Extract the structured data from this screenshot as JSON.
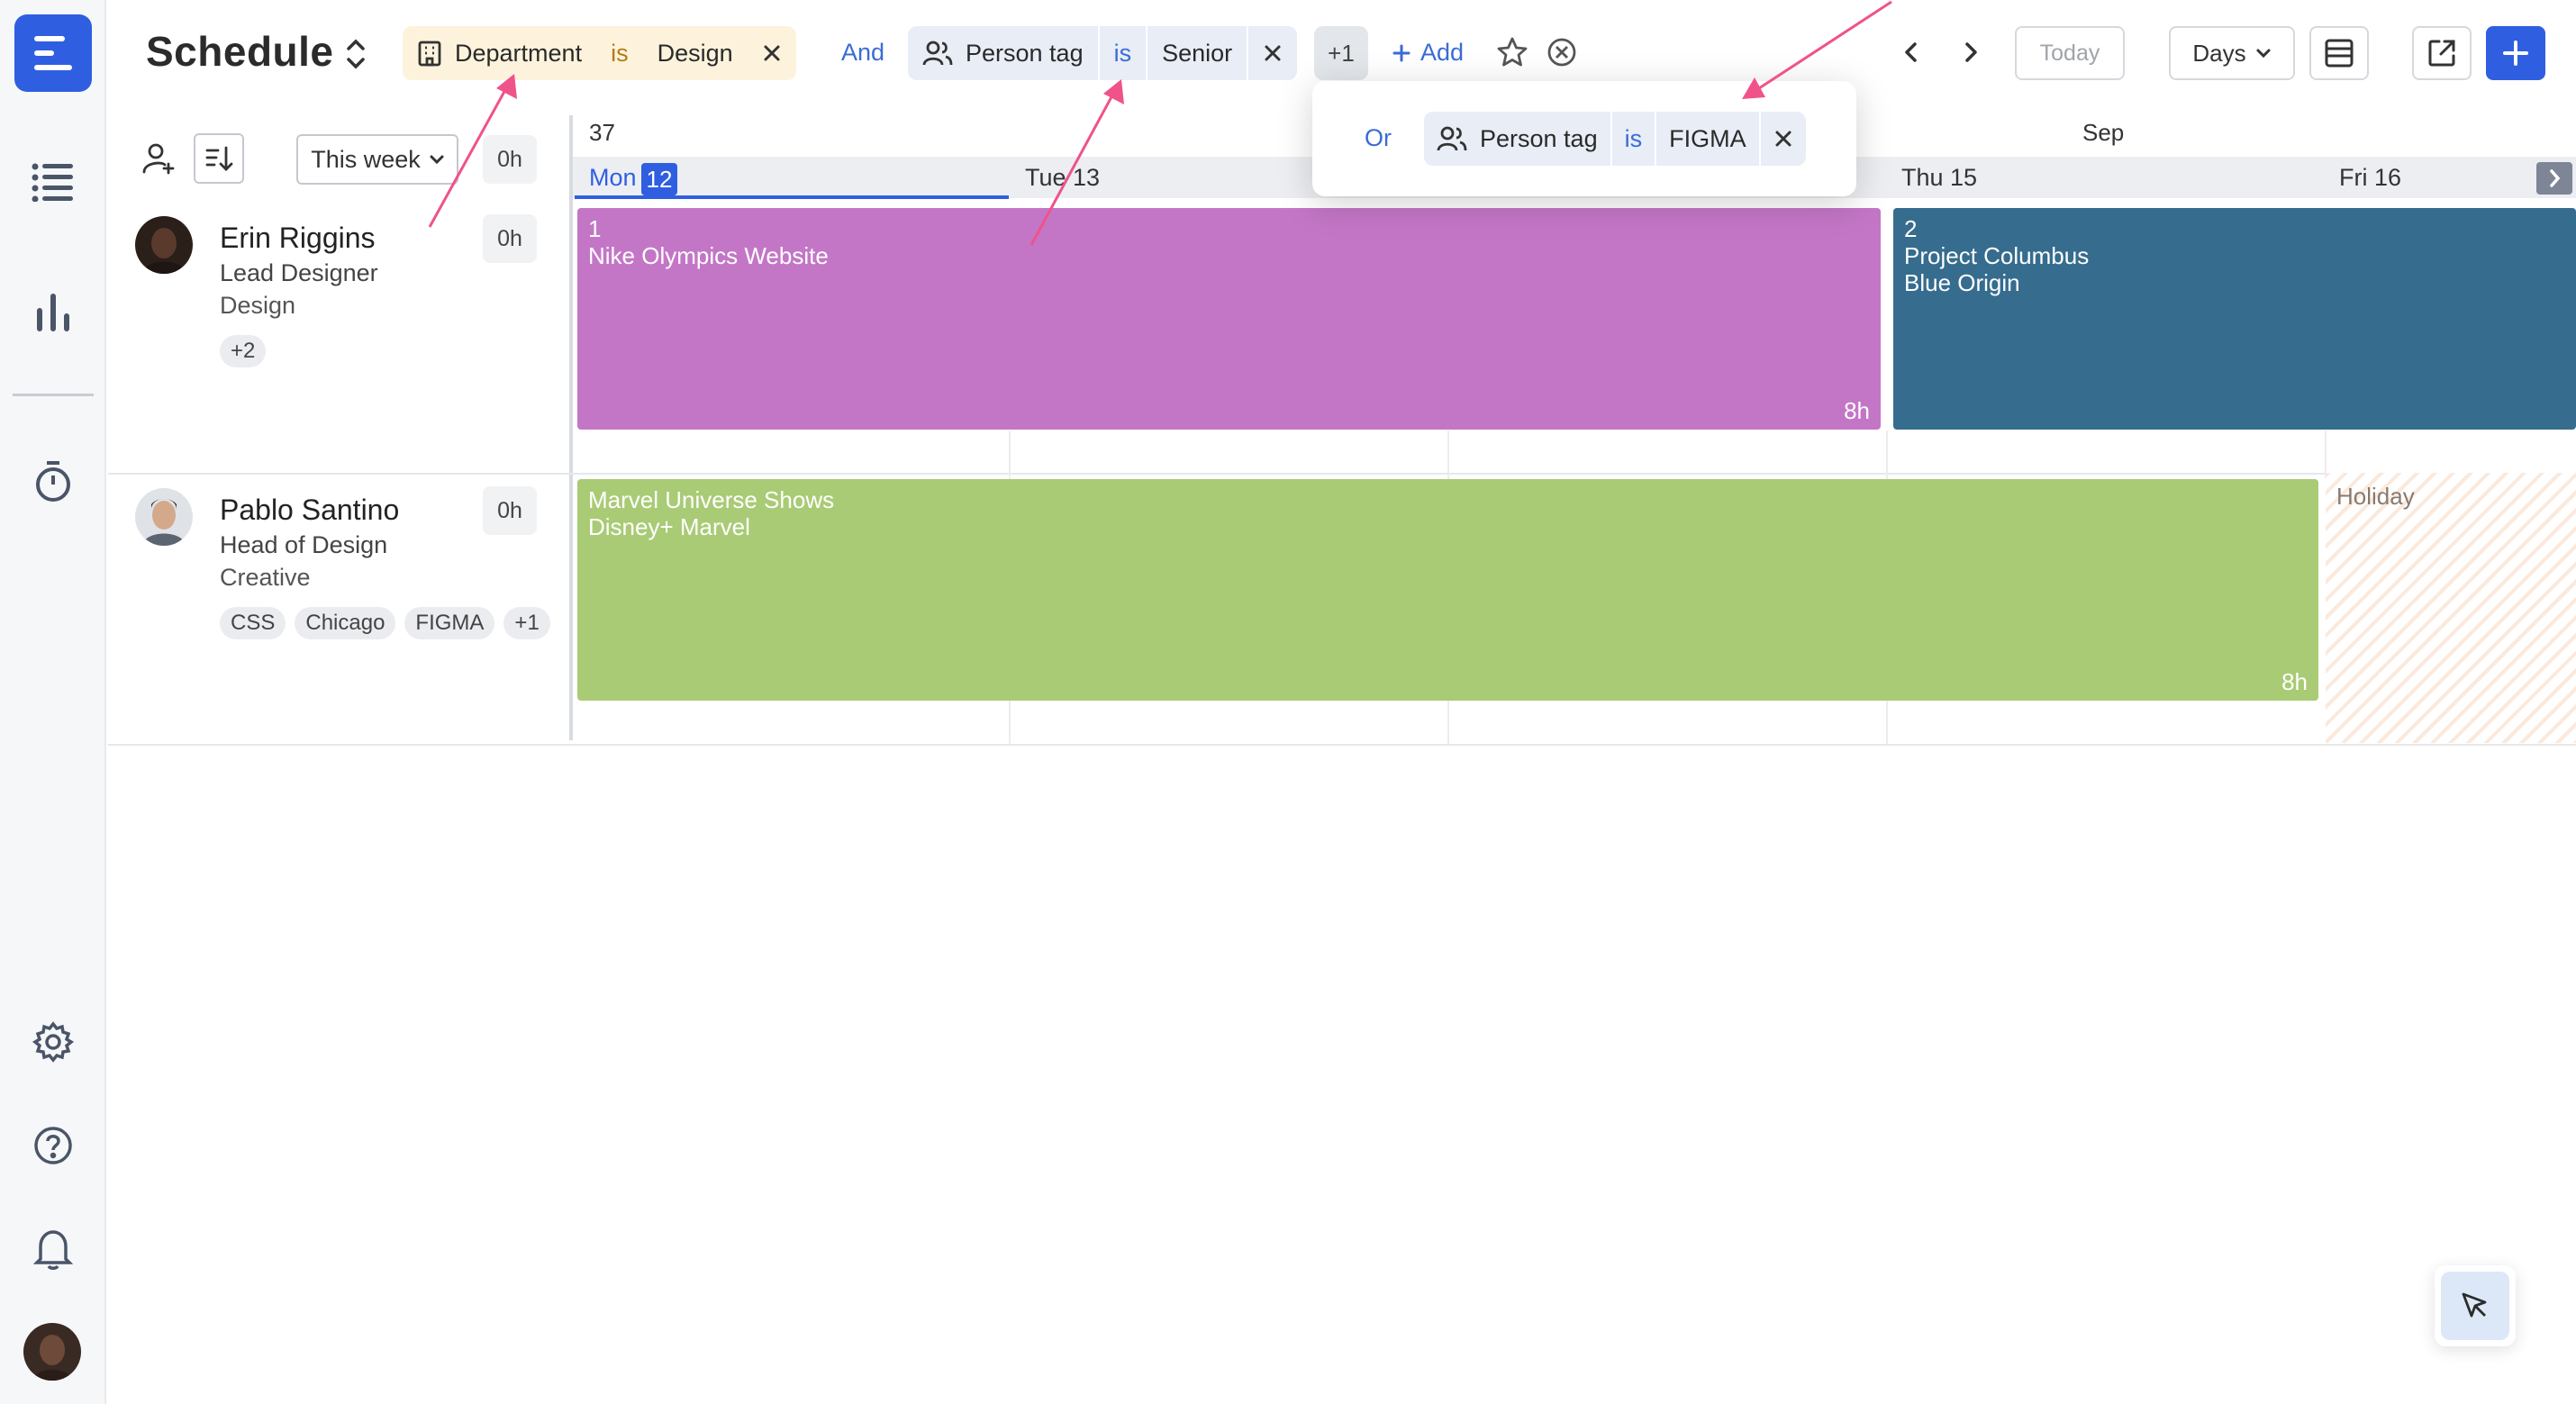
{
  "app": {
    "title": "Schedule"
  },
  "filters": {
    "department": {
      "field": "Department",
      "op": "is",
      "value": "Design"
    },
    "conjunction": "And",
    "person_tag": {
      "field": "Person tag",
      "op": "is",
      "value": "Senior"
    },
    "more_count": "+1",
    "add_label": "Add",
    "popover": {
      "conjunction": "Or",
      "field": "Person tag",
      "op": "is",
      "value": "FIGMA"
    }
  },
  "toolbar": {
    "today": "Today",
    "view": "Days"
  },
  "panel": {
    "range": "This week",
    "total_hours": "0h"
  },
  "calendar": {
    "week_number": "37",
    "month": "Sep",
    "days": [
      {
        "name": "Mon",
        "num": "12"
      },
      {
        "label": "Tue 13"
      },
      {
        "label": "Thu 15"
      },
      {
        "label": "Fri 16"
      }
    ]
  },
  "people": [
    {
      "name": "Erin Riggins",
      "role": "Lead Designer",
      "department": "Design",
      "hours": "0h",
      "tags": [
        "+2"
      ]
    },
    {
      "name": "Pablo Santino",
      "role": "Head of Design",
      "department": "Creative",
      "hours": "0h",
      "tags": [
        "CSS",
        "Chicago",
        "FIGMA",
        "+1"
      ]
    }
  ],
  "allocations": [
    {
      "count": "1",
      "project": "Nike Olympics Website",
      "client": "",
      "hours": "8h",
      "color": "#c376c6"
    },
    {
      "count": "2",
      "project": "Project Columbus",
      "client": "Blue Origin",
      "hours": "",
      "color": "#366c8e"
    },
    {
      "count": "",
      "project": "Marvel Universe Shows",
      "client": "Disney+ Marvel",
      "hours": "8h",
      "color": "#a9cb75"
    }
  ],
  "holiday": {
    "label": "Holiday"
  },
  "colors": {
    "accent": "#2f5fe0",
    "annotation": "#f0528a"
  }
}
